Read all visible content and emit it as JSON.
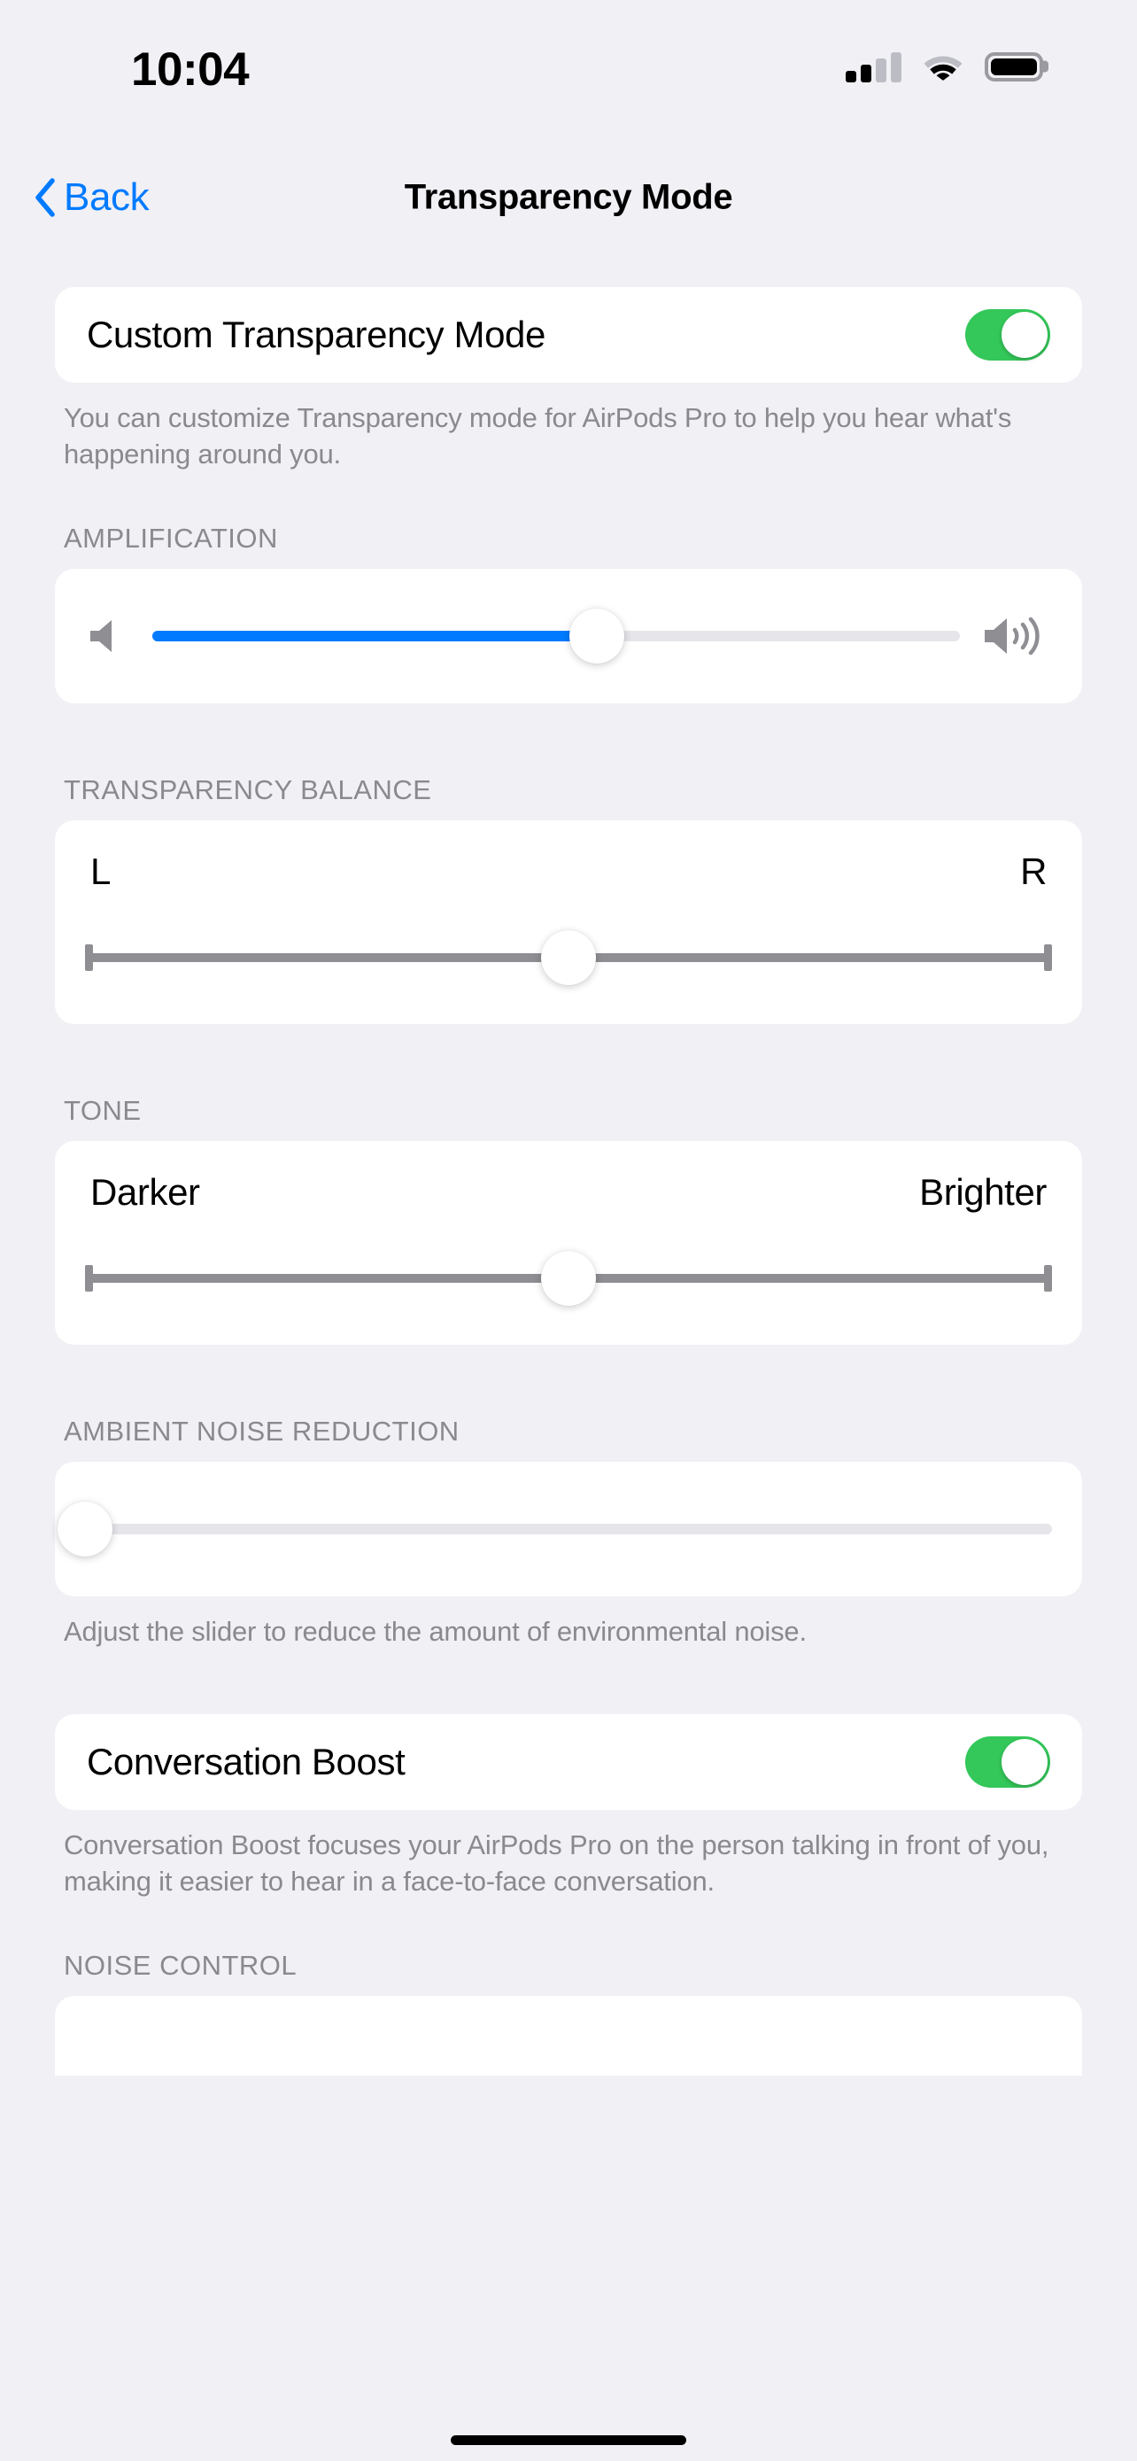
{
  "status_bar": {
    "time": "10:04",
    "signal_icon": "cellular-signal-icon",
    "signal_bars_filled": 2,
    "signal_bars_total": 4,
    "wifi_icon": "wifi-icon",
    "battery_icon": "battery-icon",
    "battery_level_percent": 100
  },
  "nav": {
    "back_label": "Back",
    "back_icon": "chevron-left-icon",
    "title": "Transparency Mode",
    "accent_color": "#007aff"
  },
  "sections": {
    "custom_transparency": {
      "row_label": "Custom Transparency Mode",
      "toggle_state": "on",
      "toggle_on_color": "#34c759",
      "footnote": "You can customize Transparency mode for AirPods Pro to help you hear what's happening around you."
    },
    "amplification": {
      "header": "AMPLIFICATION",
      "icon_left": "speaker-low-icon",
      "icon_right": "speaker-high-icon",
      "value_percent": 55,
      "fill_color": "#007aff"
    },
    "transparency_balance": {
      "header": "TRANSPARENCY BALANCE",
      "label_left": "L",
      "label_right": "R",
      "value_percent": 50
    },
    "tone": {
      "header": "TONE",
      "label_left": "Darker",
      "label_right": "Brighter",
      "value_percent": 50
    },
    "ambient_noise_reduction": {
      "header": "AMBIENT NOISE REDUCTION",
      "value_percent": 0,
      "footnote": "Adjust the slider to reduce the amount of environmental noise."
    },
    "conversation_boost": {
      "row_label": "Conversation Boost",
      "toggle_state": "on",
      "toggle_on_color": "#34c759",
      "footnote": "Conversation Boost focuses your AirPods Pro on the person talking in front of you, making it easier to hear in a face-to-face conversation."
    },
    "noise_control": {
      "header": "NOISE CONTROL"
    }
  },
  "home_indicator": "home-indicator"
}
